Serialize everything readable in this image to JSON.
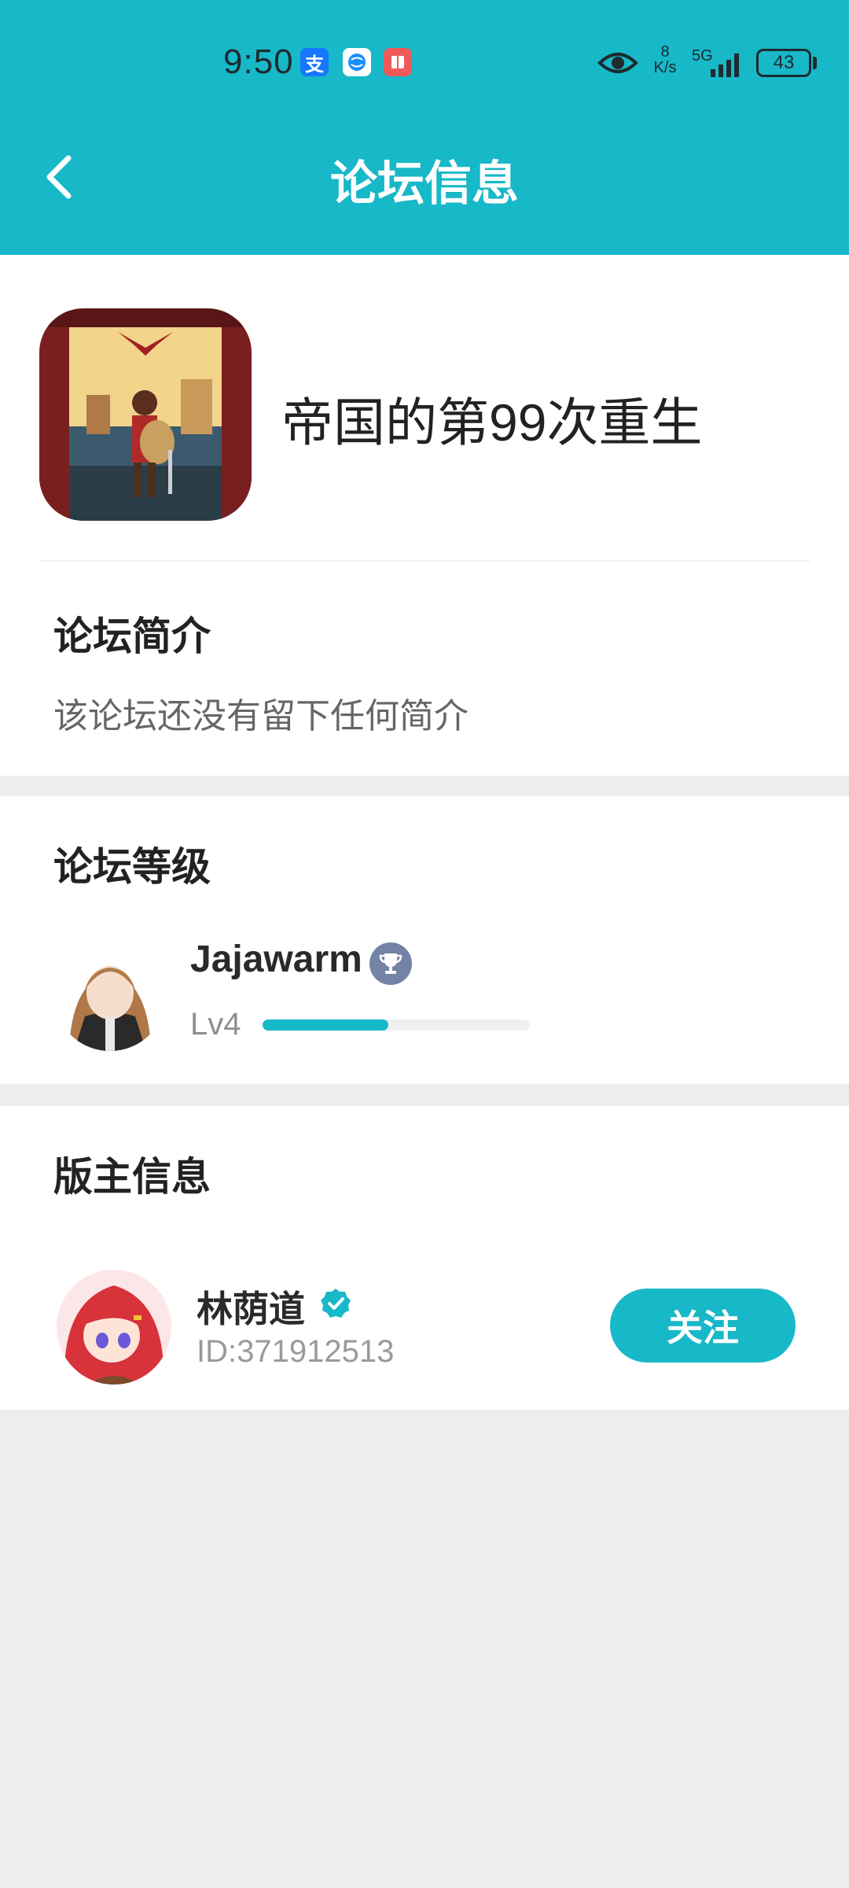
{
  "status_bar": {
    "time": "9:50",
    "app_icons": [
      "alipay-icon",
      "globe-icon",
      "book-icon"
    ],
    "speed_value": "8",
    "speed_unit": "K/s",
    "network": "5G",
    "battery": "43"
  },
  "header": {
    "title": "论坛信息",
    "back_icon": "chevron-left-icon",
    "background": "#17b8c8"
  },
  "forum": {
    "name": "帝国的第99次重生",
    "intro_title": "论坛简介",
    "intro_text": "该论坛还没有留下任何简介"
  },
  "level": {
    "section_title": "论坛等级",
    "user_name": "Jajawarm",
    "badge_icon": "trophy-icon",
    "level_label": "Lv4",
    "progress_fraction": 0.47
  },
  "moderator": {
    "section_title": "版主信息",
    "name": "林荫道",
    "verified_icon": "verified-check-icon",
    "id_text": "ID:371912513",
    "follow_label": "关注"
  },
  "colors": {
    "accent": "#17b8c8",
    "page_background": "#ededed",
    "badge": "#7482a6"
  }
}
